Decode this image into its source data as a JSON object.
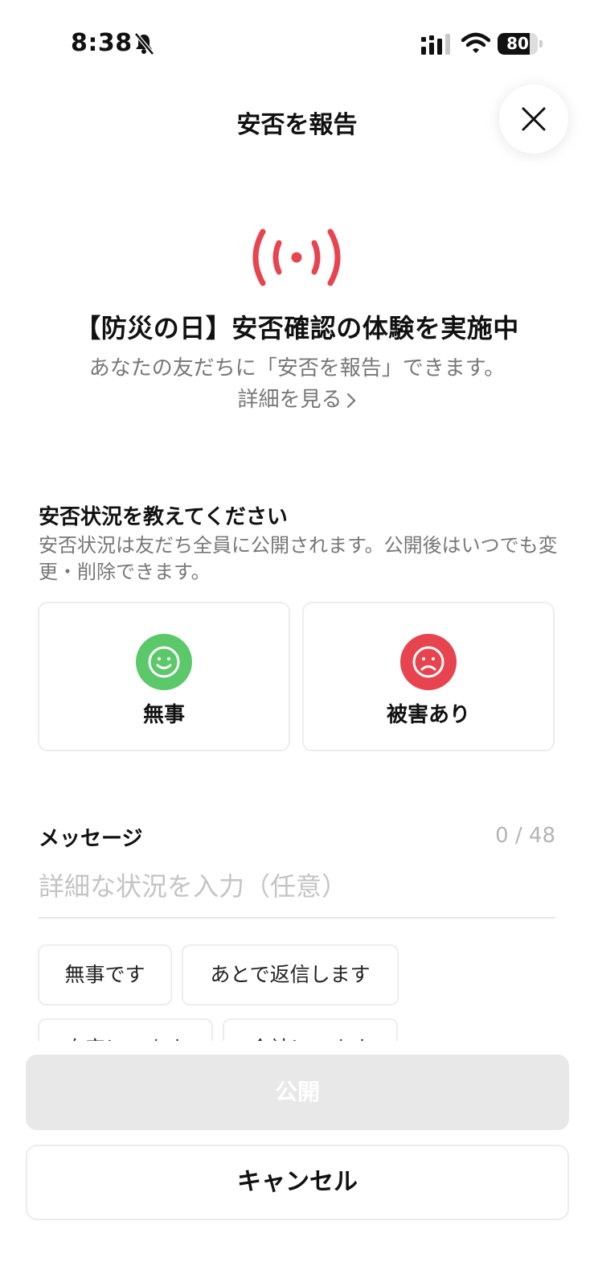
{
  "status_bar": {
    "time": "8:38",
    "battery": 80,
    "battery_label": "80"
  },
  "header": {
    "title": "安否を報告"
  },
  "banner": {
    "title": "【防災の日】安否確認の体験を実施中",
    "description": "あなたの友だちに「安否を報告」できます。",
    "details_link": "詳細を見る"
  },
  "status_section": {
    "title": "安否状況を教えてください",
    "description": "安否状況は友だち全員に公開されます。公開後はいつでも変更・削除できます。",
    "options": [
      {
        "label": "無事",
        "color": "#5bc86a",
        "icon": "smile-face-icon"
      },
      {
        "label": "被害あり",
        "color": "#e8444f",
        "icon": "sad-face-icon"
      }
    ]
  },
  "message": {
    "label": "メッセージ",
    "counter": "0 / 48",
    "placeholder": "詳細な状況を入力（任意）",
    "value": "",
    "chips": [
      "無事です",
      "あとで返信します",
      "自宅にいます",
      "会社にいます"
    ]
  },
  "actions": {
    "publish_label": "公開",
    "cancel_label": "キャンセル"
  },
  "colors": {
    "alert_red": "#e8444f",
    "safe_green": "#5bc86a",
    "muted_text": "#777777",
    "disabled_button": "#e8e8e8"
  }
}
